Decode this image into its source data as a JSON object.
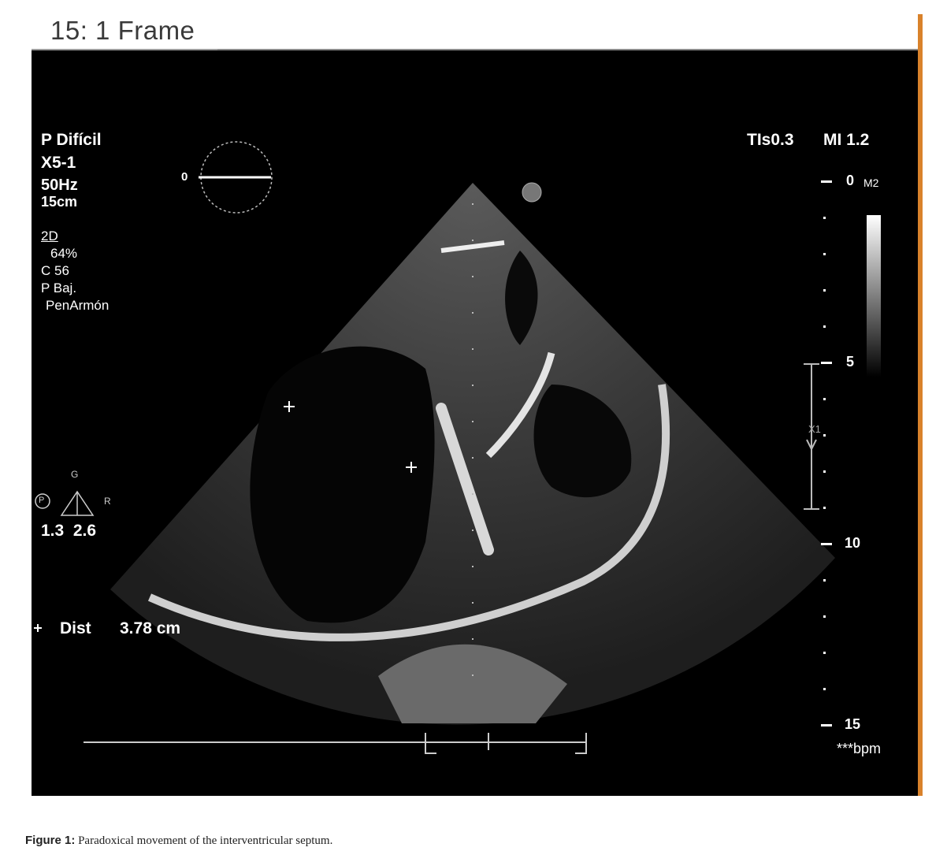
{
  "window": {
    "title": "15: 1 Frame",
    "controls": [
      "dock-icon",
      "maximize-icon",
      "close-icon"
    ]
  },
  "left_panel": {
    "preset": "P Difícil",
    "probe": "X5-1",
    "frequency": "50Hz",
    "depth": "15cm",
    "mode": "2D",
    "gain": "64%",
    "compression": "C 56",
    "power": "P Baj.",
    "harmonic": "PenArmón",
    "orientation_label": "0",
    "triangle_top": "G",
    "triangle_left": "P",
    "triangle_right": "R",
    "triangle_values": "1.3  2.6",
    "measure_label": "Dist",
    "measure_value": "3.78 cm"
  },
  "right_panel": {
    "tis": "TIs0.3",
    "mi": "MI 1.2",
    "scale_unit": "M2",
    "depth_ticks": [
      "0",
      "5",
      "10",
      "15"
    ],
    "focus_label": "X1",
    "heart_rate": "***bpm"
  },
  "caption": {
    "label": "Figure 1:",
    "text": "Paradoxical movement of the interventricular septum."
  },
  "colors": {
    "background": "#000000",
    "tab_border": "#9a9a9a",
    "accent_edge": "#d9822b"
  }
}
